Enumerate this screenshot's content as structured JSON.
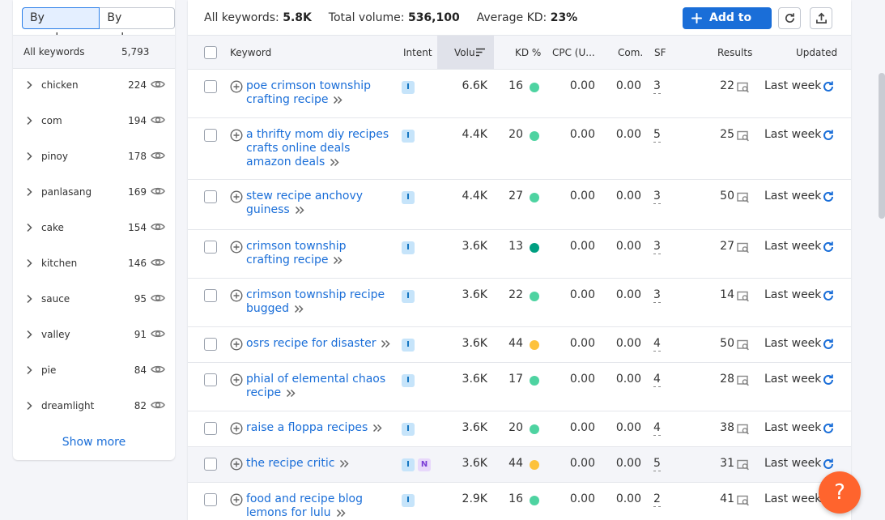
{
  "toggle": {
    "by_number": "By number",
    "by_volume": "By volume"
  },
  "groups_header": {
    "label": "All keywords",
    "count": "5,793"
  },
  "groups": [
    {
      "name": "chicken",
      "count": "224"
    },
    {
      "name": "com",
      "count": "194"
    },
    {
      "name": "pinoy",
      "count": "178"
    },
    {
      "name": "panlasang",
      "count": "169"
    },
    {
      "name": "cake",
      "count": "154"
    },
    {
      "name": "kitchen",
      "count": "146"
    },
    {
      "name": "sauce",
      "count": "95"
    },
    {
      "name": "valley",
      "count": "91"
    },
    {
      "name": "pie",
      "count": "84"
    },
    {
      "name": "dreamlight",
      "count": "82"
    }
  ],
  "show_more": "Show more",
  "summary": {
    "all_keywords_label": "All keywords:",
    "all_keywords_value": "5.8K",
    "total_volume_label": "Total volume:",
    "total_volume_value": "536,100",
    "avg_kd_label": "Average KD:",
    "avg_kd_value": "23%"
  },
  "toolbar": {
    "add_to_list": "Add to list"
  },
  "columns": {
    "keyword": "Keyword",
    "intent": "Intent",
    "volume": "Volu",
    "kd": "KD %",
    "cpc": "CPC (U...",
    "com": "Com.",
    "sf": "SF",
    "results": "Results",
    "updated": "Updated"
  },
  "colors": {
    "accent": "#1a6ed8",
    "kd_easy": "#4ed3a1",
    "kd_hard_green": "#009f81",
    "kd_medium": "#fdc23c",
    "help": "#ff642d"
  },
  "rows": [
    {
      "keyword": "poe crimson township crafting recipe",
      "intent": [
        "I"
      ],
      "volume": "6.6K",
      "kd": "16",
      "kd_color": "#4ed3a1",
      "cpc": "0.00",
      "com": "0.00",
      "sf": "3",
      "results": "22",
      "updated": "Last week"
    },
    {
      "keyword": "a thrifty mom diy recipes crafts online deals amazon deals",
      "intent": [
        "I"
      ],
      "volume": "4.4K",
      "kd": "20",
      "kd_color": "#4ed3a1",
      "cpc": "0.00",
      "com": "0.00",
      "sf": "5",
      "results": "25",
      "updated": "Last week"
    },
    {
      "keyword": "stew recipe anchovy guiness",
      "intent": [
        "I"
      ],
      "volume": "4.4K",
      "kd": "27",
      "kd_color": "#4ed3a1",
      "cpc": "0.00",
      "com": "0.00",
      "sf": "3",
      "results": "50",
      "updated": "Last week"
    },
    {
      "keyword": "crimson township crafting recipe",
      "intent": [
        "I"
      ],
      "volume": "3.6K",
      "kd": "13",
      "kd_color": "#009f81",
      "cpc": "0.00",
      "com": "0.00",
      "sf": "3",
      "results": "27",
      "updated": "Last week"
    },
    {
      "keyword": "crimson township recipe bugged",
      "intent": [
        "I"
      ],
      "volume": "3.6K",
      "kd": "22",
      "kd_color": "#4ed3a1",
      "cpc": "0.00",
      "com": "0.00",
      "sf": "3",
      "results": "14",
      "updated": "Last week"
    },
    {
      "keyword": "osrs recipe for disaster",
      "intent": [
        "I"
      ],
      "volume": "3.6K",
      "kd": "44",
      "kd_color": "#fdc23c",
      "cpc": "0.00",
      "com": "0.00",
      "sf": "4",
      "results": "50",
      "updated": "Last week"
    },
    {
      "keyword": "phial of elemental chaos recipe",
      "intent": [
        "I"
      ],
      "volume": "3.6K",
      "kd": "17",
      "kd_color": "#4ed3a1",
      "cpc": "0.00",
      "com": "0.00",
      "sf": "4",
      "results": "28",
      "updated": "Last week"
    },
    {
      "keyword": "raise a floppa recipes",
      "intent": [
        "I"
      ],
      "volume": "3.6K",
      "kd": "20",
      "kd_color": "#4ed3a1",
      "cpc": "0.00",
      "com": "0.00",
      "sf": "4",
      "results": "38",
      "updated": "Last week"
    },
    {
      "keyword": "the recipe critic",
      "intent": [
        "I",
        "N"
      ],
      "volume": "3.6K",
      "kd": "44",
      "kd_color": "#fdc23c",
      "cpc": "0.00",
      "com": "0.00",
      "sf": "5",
      "results": "31",
      "updated": "Last week"
    },
    {
      "keyword": "food and recipe blog lemons for lulu",
      "intent": [
        "I"
      ],
      "volume": "2.9K",
      "kd": "16",
      "kd_color": "#4ed3a1",
      "cpc": "0.00",
      "com": "0.00",
      "sf": "2",
      "results": "41",
      "updated": "Last week"
    }
  ],
  "help": {
    "label": "?"
  }
}
